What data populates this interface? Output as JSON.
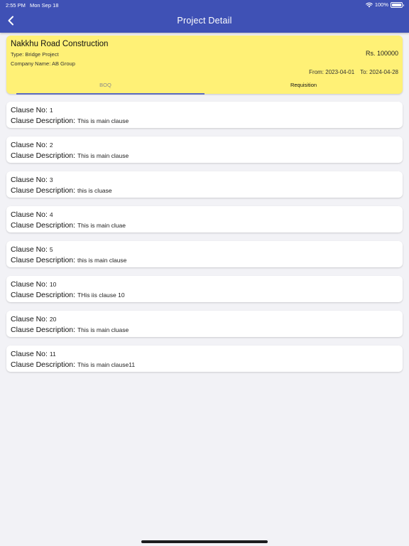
{
  "status_bar": {
    "time": "2:55 PM",
    "date": "Mon Sep 18",
    "battery": "100%"
  },
  "nav": {
    "title": "Project Detail",
    "back_icon": "chevron-left-icon"
  },
  "project": {
    "name": "Nakkhu Road Construction",
    "type": "Type: Bridge Project",
    "company": "Company Name: AB Group",
    "amount": "Rs. 100000",
    "from": "From: 2023-04-01",
    "to": "To: 2024-04-28"
  },
  "tabs": [
    {
      "label": "BOQ",
      "active": true
    },
    {
      "label": "Requisition",
      "active": false
    }
  ],
  "labels": {
    "clause_no": "Clause No:",
    "clause_description": "Clause Description:"
  },
  "clauses": [
    {
      "no": "1",
      "description": "This is main clause"
    },
    {
      "no": "2",
      "description": "This is main clause"
    },
    {
      "no": "3",
      "description": "this is cluase"
    },
    {
      "no": "4",
      "description": "This is main cluae"
    },
    {
      "no": "5",
      "description": "this is main clause"
    },
    {
      "no": "10",
      "description": "THis iis clause 10"
    },
    {
      "no": "20",
      "description": "This is main cluase"
    },
    {
      "no": "11",
      "description": "This is main clause11"
    }
  ],
  "colors": {
    "app_bar": "#3f51b5",
    "project_card": "#fff176",
    "tab_indicator": "#5c6bc0",
    "background": "#f2f2f6"
  }
}
